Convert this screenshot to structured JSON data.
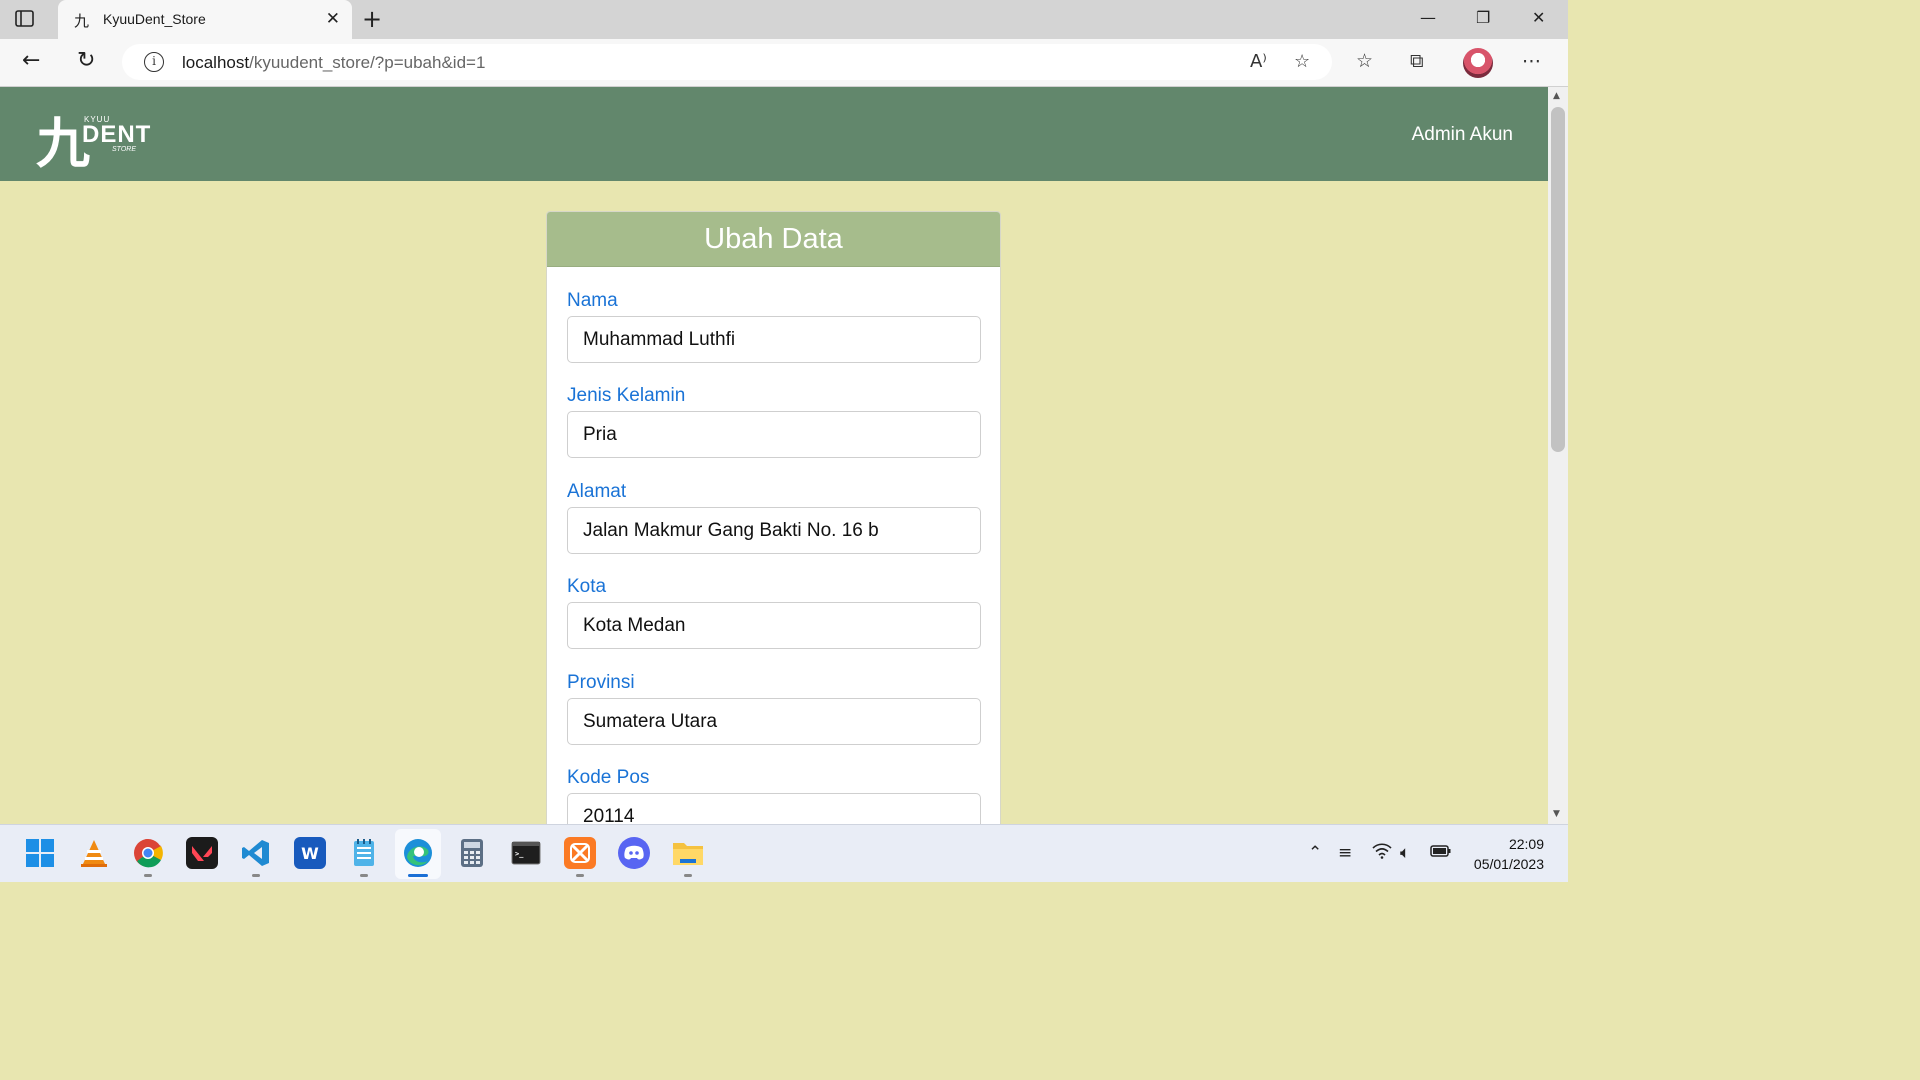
{
  "browser": {
    "tab_title": "KyuuDent_Store",
    "tab_favicon": "九",
    "url_host": "localhost",
    "url_path": "/kyuudent_store/?p=ubah&id=1"
  },
  "site": {
    "logo_kanji": "九",
    "logo_top": "KYUU",
    "logo_main": "DENT",
    "logo_bottom": "STORE",
    "account_link": "Admin Akun"
  },
  "form": {
    "title": "Ubah Data",
    "fields": [
      {
        "label": "Nama",
        "value": "Muhammad Luthfi"
      },
      {
        "label": "Jenis Kelamin",
        "value": "Pria"
      },
      {
        "label": "Alamat",
        "value": "Jalan Makmur Gang Bakti No. 16 b"
      },
      {
        "label": "Kota",
        "value": "Kota Medan"
      },
      {
        "label": "Provinsi",
        "value": "Sumatera Utara"
      },
      {
        "label": "Kode Pos",
        "value": "20114"
      }
    ]
  },
  "taskbar": {
    "time": "22:09",
    "date": "05/01/2023",
    "apps": [
      "windows-start",
      "vlc",
      "chrome",
      "valorant",
      "vscode",
      "word",
      "notepad",
      "edge",
      "calculator",
      "terminal",
      "xampp",
      "discord",
      "file-explorer"
    ]
  },
  "colors": {
    "header": "#62876c",
    "page_bg": "#e8e6b0",
    "card_header": "#a6bc8c",
    "label": "#1a73d6"
  }
}
